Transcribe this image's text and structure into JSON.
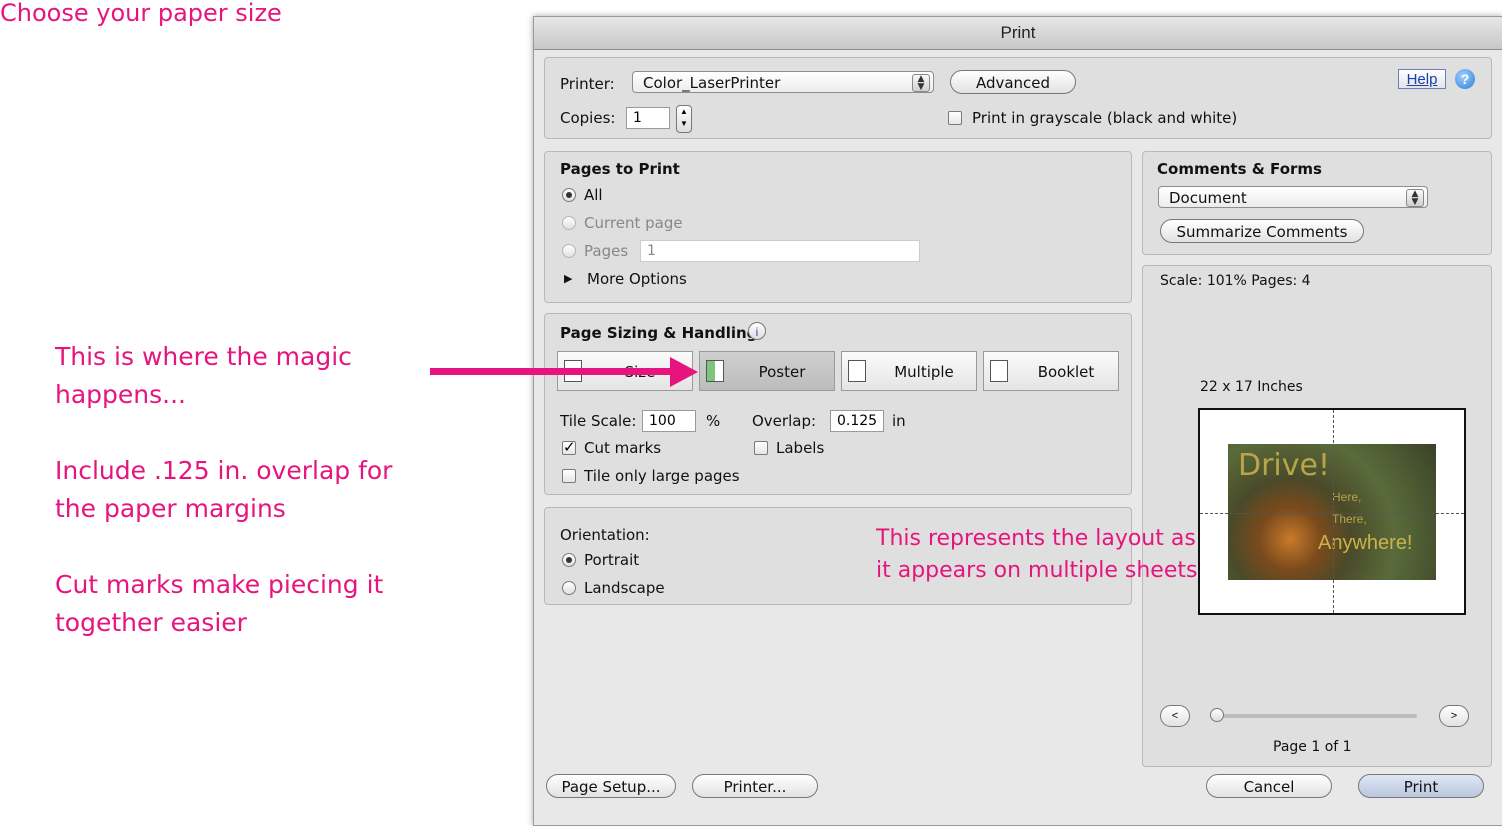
{
  "annotations": {
    "top": "Choose your paper size",
    "magic_line1": "This is where the magic",
    "magic_line2": "happens...",
    "overlap_line1": "Include .125 in. overlap for",
    "overlap_line2": "the paper margins",
    "cut_line1": "Cut marks make piecing it",
    "cut_line2": "together easier",
    "layout_line1": "This represents the layout as",
    "layout_line2": "it appears on multiple sheets"
  },
  "dialog": {
    "title": "Print",
    "printer_label": "Printer:",
    "printer_value": "Color_LaserPrinter",
    "advanced_label": "Advanced",
    "help_label": "Help",
    "copies_label": "Copies:",
    "copies_value": "1",
    "grayscale_label": "Print in grayscale (black and white)"
  },
  "pages_to_print": {
    "heading": "Pages to Print",
    "all_label": "All",
    "current_label": "Current page",
    "pages_label": "Pages",
    "pages_value": "1",
    "more_options_label": "More Options"
  },
  "sizing": {
    "heading": "Page Sizing & Handling",
    "buttons": [
      {
        "label": "Size"
      },
      {
        "label": "Poster"
      },
      {
        "label": "Multiple"
      },
      {
        "label": "Booklet"
      }
    ],
    "tile_scale_label": "Tile Scale:",
    "tile_scale_value": "100",
    "percent": "%",
    "overlap_label": "Overlap:",
    "overlap_value": "0.125",
    "overlap_unit": "in",
    "cut_marks_label": "Cut marks",
    "labels_label": "Labels",
    "tile_large_label": "Tile only large pages"
  },
  "orientation": {
    "heading": "Orientation:",
    "portrait_label": "Portrait",
    "landscape_label": "Landscape"
  },
  "comments": {
    "heading": "Comments & Forms",
    "select_value": "Document",
    "summarize_label": "Summarize Comments"
  },
  "preview": {
    "scale_text": "Scale: 101% Pages: 4",
    "size_text": "22 x 17 Inches",
    "image_big": "Drive!",
    "image_here": "Here,",
    "image_there": "There,",
    "image_anywhere": "Anywhere!",
    "page_text": "Page 1 of 1",
    "prev_label": "<",
    "next_label": ">"
  },
  "footer": {
    "page_setup_label": "Page Setup...",
    "printer_label": "Printer...",
    "cancel_label": "Cancel",
    "print_label": "Print"
  },
  "colors": {
    "annotation": "#e6157e",
    "dialog_bg": "#e8e8e8"
  }
}
